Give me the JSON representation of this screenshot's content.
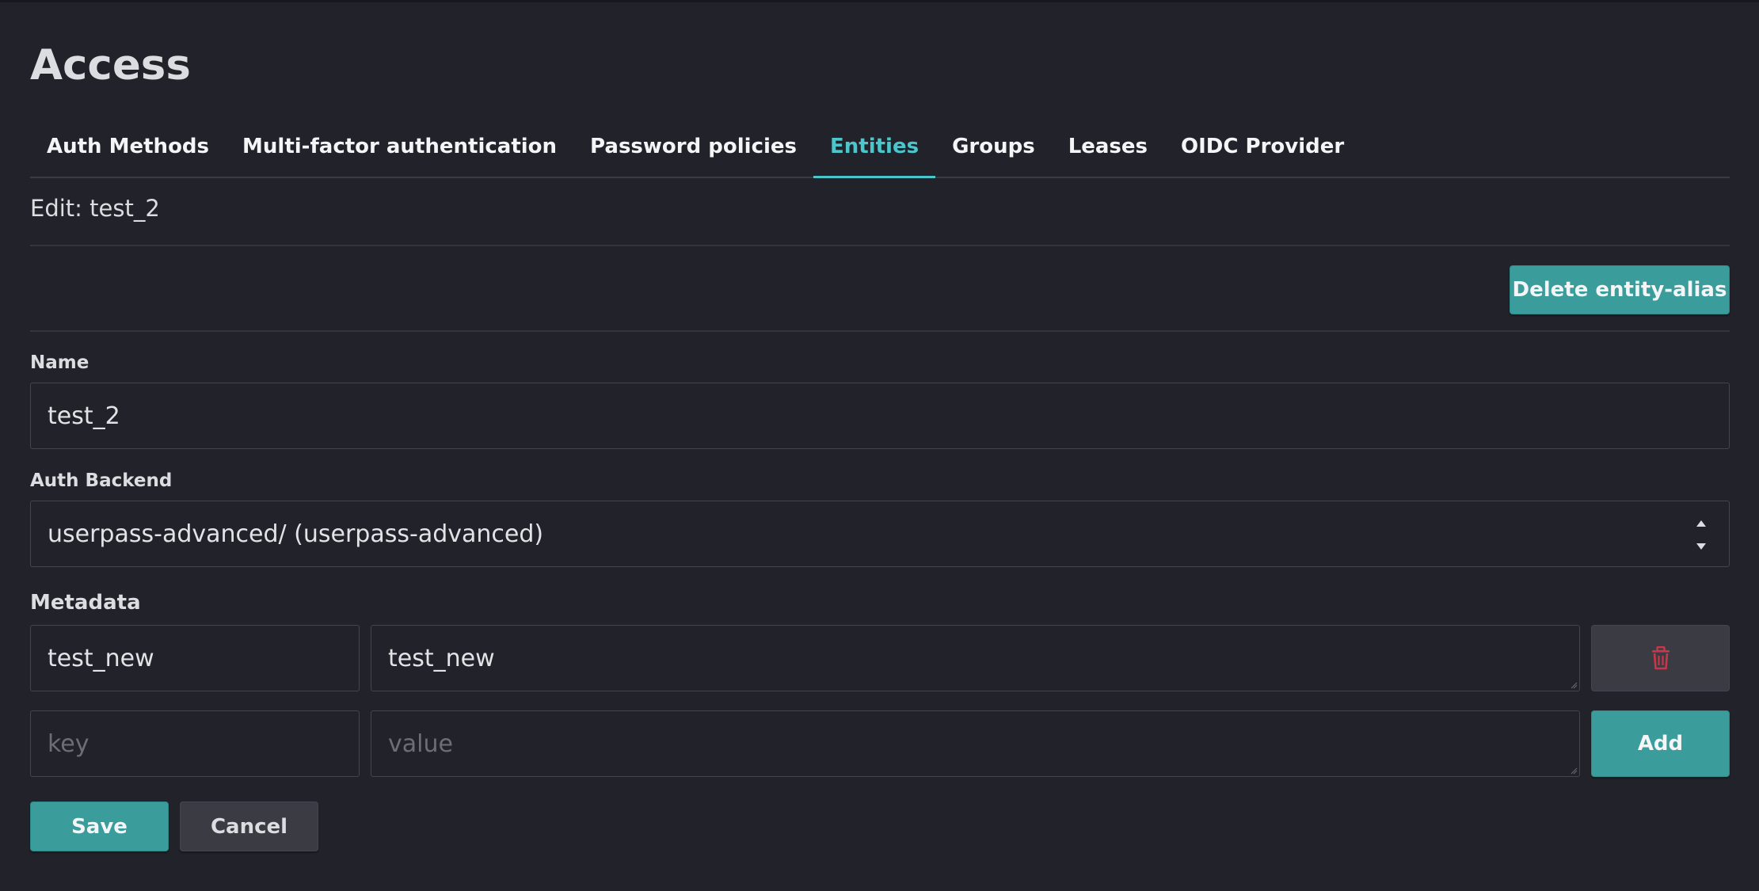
{
  "page": {
    "title": "Access",
    "subtitle": "Edit: test_2"
  },
  "tabs": [
    {
      "label": "Auth Methods",
      "active": false
    },
    {
      "label": "Multi-factor authentication",
      "active": false
    },
    {
      "label": "Password policies",
      "active": false
    },
    {
      "label": "Entities",
      "active": true
    },
    {
      "label": "Groups",
      "active": false
    },
    {
      "label": "Leases",
      "active": false
    },
    {
      "label": "OIDC Provider",
      "active": false
    }
  ],
  "toolbar": {
    "delete_label": "Delete entity-alias"
  },
  "form": {
    "name_label": "Name",
    "name_value": "test_2",
    "backend_label": "Auth Backend",
    "backend_value": "userpass-advanced/ (userpass-advanced)",
    "metadata_label": "Metadata",
    "metadata_rows": [
      {
        "key": "test_new",
        "value": "test_new"
      }
    ],
    "new_key_placeholder": "key",
    "new_value_placeholder": "value",
    "add_label": "Add"
  },
  "actions": {
    "save_label": "Save",
    "cancel_label": "Cancel"
  },
  "icons": {
    "delete_row": "trash-icon",
    "select_arrows": "sort-arrows-icon"
  },
  "colors": {
    "background": "#22232a",
    "accent": "#4cc6cd",
    "primary_button": "#3a9c9b",
    "danger_icon": "#c8374a"
  }
}
